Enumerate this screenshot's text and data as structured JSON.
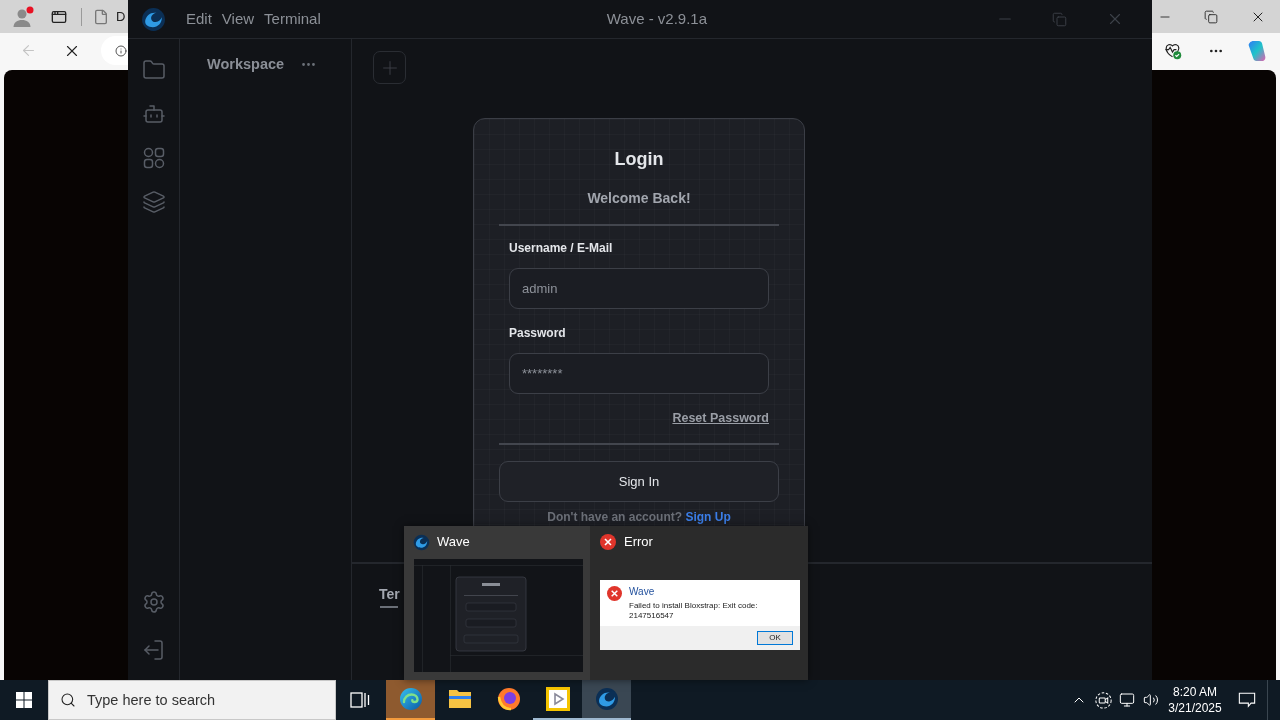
{
  "browser": {
    "tab_title": "D",
    "back_disabled": true
  },
  "app": {
    "title": "Wave - v2.9.1a",
    "menu": [
      "Edit",
      "View",
      "Terminal"
    ],
    "workspace": {
      "title": "Workspace"
    },
    "login": {
      "title": "Login",
      "subtitle": "Welcome Back!",
      "fields": [
        {
          "label": "Username / E-Mail",
          "placeholder": "admin"
        },
        {
          "label": "Password",
          "placeholder": "********"
        }
      ],
      "reset_link": "Reset Password",
      "submit": "Sign In",
      "signup_prompt": "Don't have an account?",
      "signup_link": "Sign Up"
    },
    "terminal": {
      "tabs": [
        {
          "label": "Ter",
          "selected": true
        }
      ]
    }
  },
  "window_previews": [
    {
      "kind": "app",
      "title": "Wave",
      "selected": true
    },
    {
      "kind": "error",
      "title": "Error",
      "selected": false,
      "dialog": {
        "title": "Wave",
        "message": "Failed to install Bloxstrap: Exit code: 2147516547",
        "button": "OK"
      }
    }
  ],
  "taskbar": {
    "search_placeholder": "Type here to search",
    "apps": [
      {
        "kind": "edge",
        "open": true,
        "active": false,
        "flashing": true
      },
      {
        "kind": "explorer",
        "open": false,
        "active": false,
        "flashing": false
      },
      {
        "kind": "firefox",
        "open": false,
        "active": false,
        "flashing": false
      },
      {
        "kind": "media",
        "open": true,
        "active": false,
        "flashing": false
      },
      {
        "kind": "wave",
        "open": true,
        "active": true,
        "flashing": false
      }
    ],
    "time": "8:20 AM",
    "date": "3/21/2025"
  }
}
